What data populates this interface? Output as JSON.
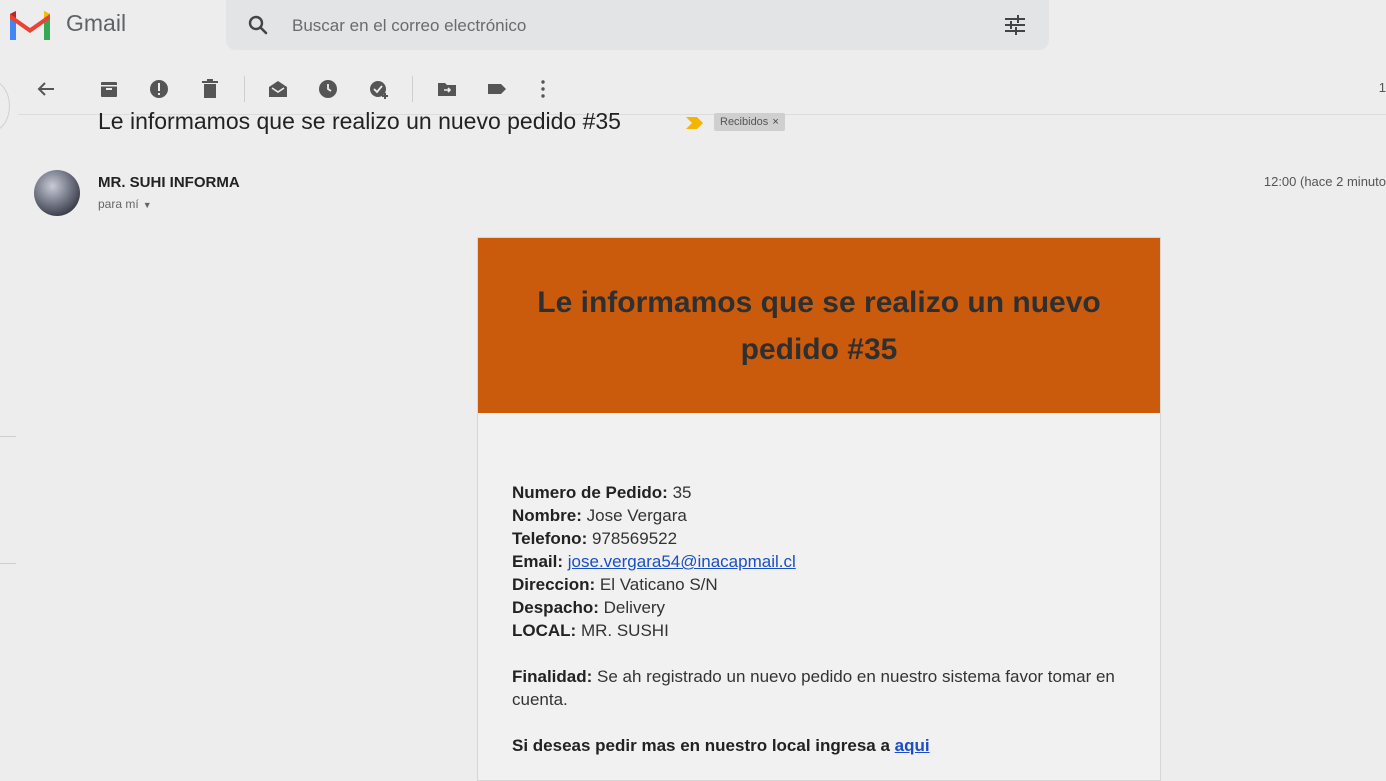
{
  "app": {
    "name": "Gmail"
  },
  "search": {
    "placeholder": "Buscar en el correo electrónico"
  },
  "toolbar": {
    "icons": [
      "back-arrow-icon",
      "archive-icon",
      "report-spam-icon",
      "delete-icon",
      "mark-unread-icon",
      "snooze-icon",
      "add-task-icon",
      "move-to-icon",
      "label-icon",
      "more-icon"
    ],
    "page_count": "1"
  },
  "message": {
    "subject": "Le informamos que se realizo un nuevo pedido #35",
    "label": "Recibidos",
    "label_close": "×",
    "sender": "MR. SUHI INFORMA",
    "to": "para mí",
    "time": "12:00 (hace 2 minuto"
  },
  "email": {
    "banner_title": "Le informamos que se realizo un nuevo pedido #35",
    "fields": [
      {
        "label": "Numero de Pedido:",
        "value": "35"
      },
      {
        "label": "Nombre:",
        "value": "Jose Vergara"
      },
      {
        "label": "Telefono:",
        "value": "978569522"
      },
      {
        "label": "Email:",
        "value": "jose.vergara54@inacapmail.cl",
        "link": true
      },
      {
        "label": "Direccion:",
        "value": "El Vaticano S/N"
      },
      {
        "label": "Despacho:",
        "value": "Delivery"
      },
      {
        "label": "LOCAL:",
        "value": "MR. SUSHI"
      }
    ],
    "finalidad_label": "Finalidad:",
    "finalidad_text": "Se ah registrado un nuevo pedido en nuestro sistema favor tomar en cuenta.",
    "cta_text": "Si deseas pedir mas en nuestro local ingresa a",
    "cta_link": "aqui"
  },
  "colors": {
    "banner": "#cb5b0c",
    "link": "#1a4fc4",
    "important": "#f4b400"
  }
}
